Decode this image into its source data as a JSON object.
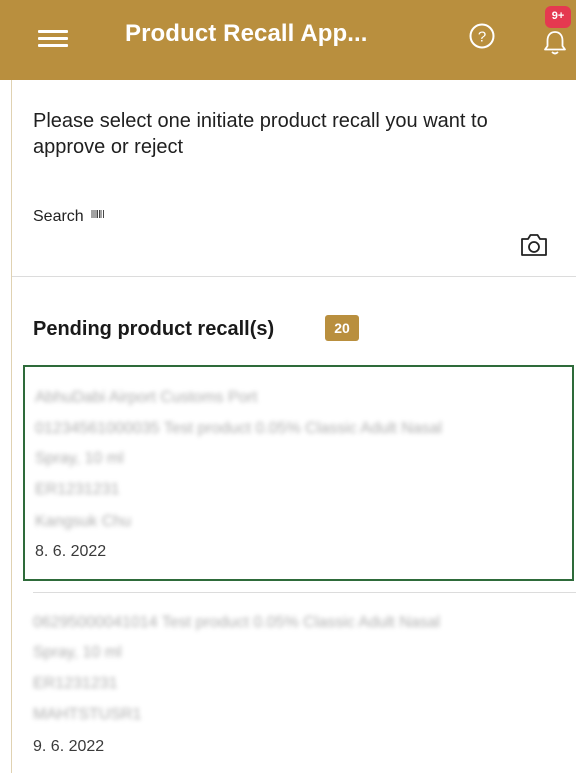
{
  "header": {
    "title": "Product Recall App...",
    "notification_badge": "9+",
    "bg_color": "#b98f3e"
  },
  "icons": {
    "menu": "hamburger-menu-icon",
    "help": "question-circle-icon",
    "notifications": "bell-icon",
    "scan": "camera-icon",
    "barcode": "barcode-icon"
  },
  "instruction": "Please select one initiate product recall you want to approve or reject",
  "search": {
    "label": "Search"
  },
  "pending": {
    "title": "Pending product recall(s)",
    "count": "20"
  },
  "recalls": [
    {
      "location": "AbhuDabi Airport Customs Port",
      "product_line1": "01234561000035 Test product 0.05% Classic Adult Nasal",
      "product_line2": "Spray, 10 ml",
      "code": "ER1231231",
      "user": "Kangsuk Chu",
      "date": "8. 6. 2022"
    },
    {
      "product_line1": "06295000041014 Test product 0.05% Classic Adult Nasal",
      "product_line2": "Spray, 10 ml",
      "code": "ER1231231",
      "user": "MAHTSTUSR1",
      "date": "9. 6. 2022"
    }
  ]
}
